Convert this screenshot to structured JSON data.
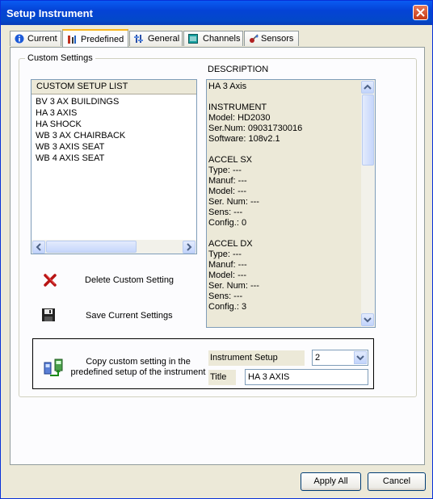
{
  "window": {
    "title": "Setup Instrument"
  },
  "tabs": [
    {
      "label": "Current",
      "icon": "info-icon"
    },
    {
      "label": "Predefined",
      "icon": "instrument-icon",
      "active": true
    },
    {
      "label": "General",
      "icon": "settings-icon"
    },
    {
      "label": "Channels",
      "icon": "channels-icon"
    },
    {
      "label": "Sensors",
      "icon": "sensors-icon"
    }
  ],
  "custom_settings": {
    "group_label": "Custom Settings",
    "list_header": "CUSTOM SETUP LIST",
    "items": [
      "BV 3 AX BUILDINGS",
      "HA 3 AXIS",
      "HA SHOCK",
      "WB 3 AX CHAIRBACK",
      "WB 3 AXIS SEAT",
      "WB 4 AXIS SEAT"
    ]
  },
  "description": {
    "label": "DESCRIPTION",
    "lines": [
      "HA 3 Axis",
      "",
      "INSTRUMENT",
      "Model: HD2030",
      "Ser.Num: 09031730016",
      "Software: 108v2.1",
      "",
      "ACCEL SX",
      "Type: ---",
      "Manuf: ---",
      "Model: ---",
      "Ser. Num: ---",
      "Sens: ---",
      "Config.: 0",
      "",
      "ACCEL DX",
      "Type: ---",
      "Manuf: ---",
      "Model: ---",
      "Ser. Num: ---",
      "Sens: ---",
      "Config.: 3"
    ]
  },
  "actions": {
    "delete_label": "Delete Custom Setting",
    "save_label": "Save Current Settings"
  },
  "copy": {
    "line1": "Copy custom setting in the",
    "line2": "predefined setup of the instrument",
    "instrument_setup_label": "Instrument Setup",
    "instrument_setup_value": "2",
    "title_label": "Title",
    "title_value": "HA 3 AXIS"
  },
  "buttons": {
    "apply_all": "Apply All",
    "cancel": "Cancel"
  },
  "colors": {
    "titlebar": "#0443d6",
    "accent_tab": "#f9b51b",
    "delete_icon": "#b81414"
  }
}
